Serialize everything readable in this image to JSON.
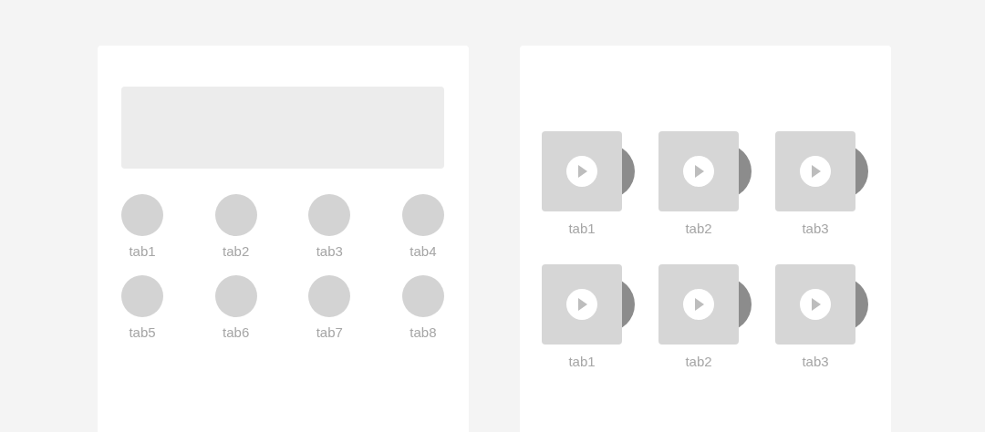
{
  "left_card": {
    "tabs": [
      {
        "label": "tab1"
      },
      {
        "label": "tab2"
      },
      {
        "label": "tab3"
      },
      {
        "label": "tab4"
      },
      {
        "label": "tab5"
      },
      {
        "label": "tab6"
      },
      {
        "label": "tab7"
      },
      {
        "label": "tab8"
      }
    ]
  },
  "right_card": {
    "albums": [
      {
        "label": "tab1"
      },
      {
        "label": "tab2"
      },
      {
        "label": "tab3"
      },
      {
        "label": "tab1"
      },
      {
        "label": "tab2"
      },
      {
        "label": "tab3"
      }
    ]
  }
}
